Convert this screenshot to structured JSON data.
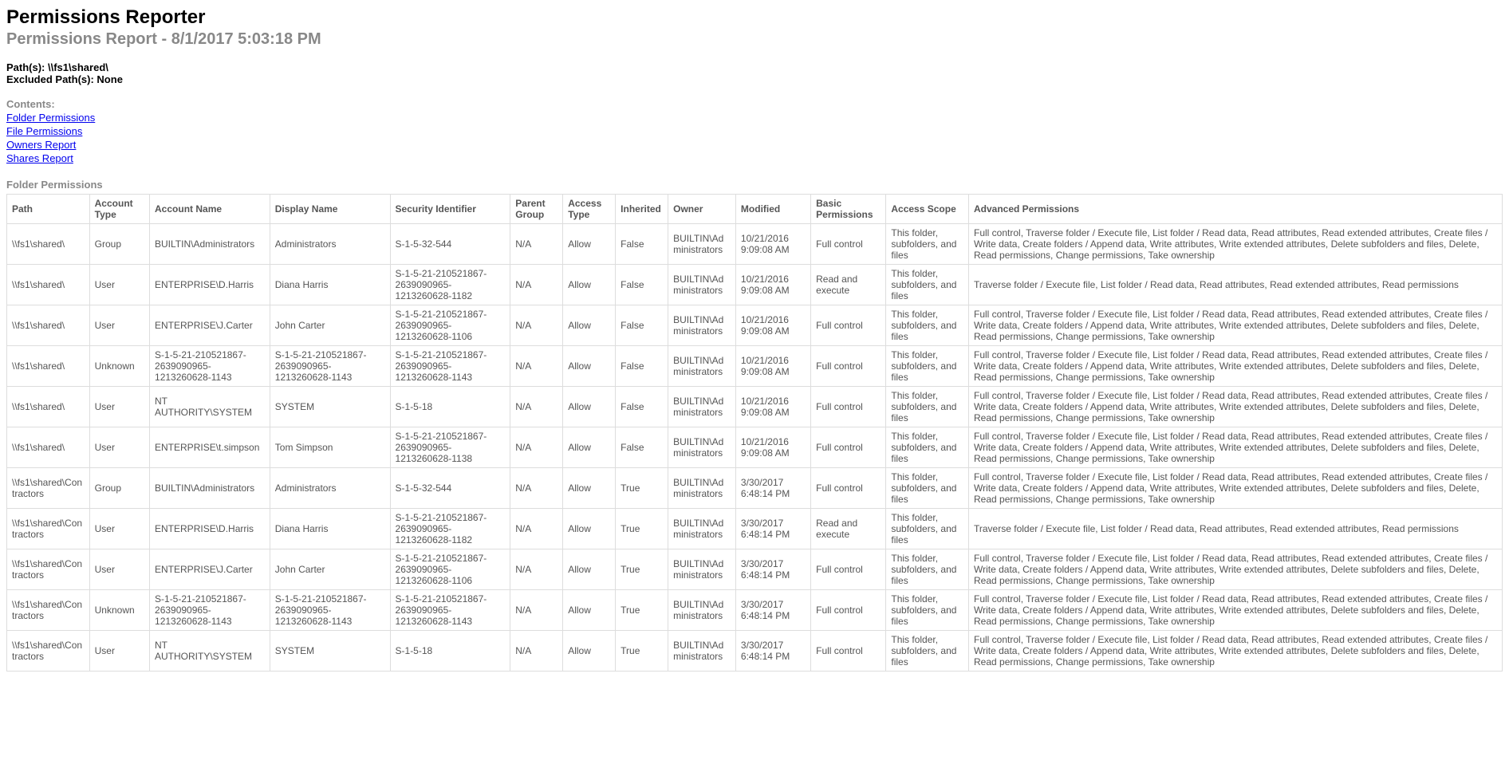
{
  "header": {
    "title": "Permissions Reporter",
    "subtitle": "Permissions Report - 8/1/2017 5:03:18 PM",
    "paths_label": "Path(s): ",
    "paths_value": "\\\\fs1\\shared\\",
    "excluded_label": "Excluded Path(s): ",
    "excluded_value": "None"
  },
  "contents": {
    "label": "Contents:",
    "links": [
      "Folder Permissions",
      "File Permissions",
      "Owners Report",
      "Shares Report"
    ]
  },
  "section": {
    "title": "Folder Permissions"
  },
  "table": {
    "headers": [
      "Path",
      "Account Type",
      "Account Name",
      "Display Name",
      "Security Identifier",
      "Parent Group",
      "Access Type",
      "Inherited",
      "Owner",
      "Modified",
      "Basic Permissions",
      "Access Scope",
      "Advanced Permissions"
    ],
    "rows": [
      {
        "path": "\\\\fs1\\shared\\",
        "acct_type": "Group",
        "acct_name": "BUILTIN\\Administrators",
        "display": "Administrators",
        "sid": "S-1-5-32-544",
        "parent": "N/A",
        "access": "Allow",
        "inherited": "False",
        "owner": "BUILTIN\\Administrators",
        "modified": "10/21/2016 9:09:08 AM",
        "basic": "Full control",
        "scope": "This folder, subfolders, and files",
        "advanced": "Full control, Traverse folder / Execute file, List folder / Read data, Read attributes, Read extended attributes, Create files / Write data, Create folders / Append data, Write attributes, Write extended attributes, Delete subfolders and files, Delete, Read permissions, Change permissions, Take ownership"
      },
      {
        "path": "\\\\fs1\\shared\\",
        "acct_type": "User",
        "acct_name": "ENTERPRISE\\D.Harris",
        "display": "Diana Harris",
        "sid": "S-1-5-21-210521867-2639090965-1213260628-1182",
        "parent": "N/A",
        "access": "Allow",
        "inherited": "False",
        "owner": "BUILTIN\\Administrators",
        "modified": "10/21/2016 9:09:08 AM",
        "basic": "Read and execute",
        "scope": "This folder, subfolders, and files",
        "advanced": "Traverse folder / Execute file, List folder / Read data, Read attributes, Read extended attributes, Read permissions"
      },
      {
        "path": "\\\\fs1\\shared\\",
        "acct_type": "User",
        "acct_name": "ENTERPRISE\\J.Carter",
        "display": "John Carter",
        "sid": "S-1-5-21-210521867-2639090965-1213260628-1106",
        "parent": "N/A",
        "access": "Allow",
        "inherited": "False",
        "owner": "BUILTIN\\Administrators",
        "modified": "10/21/2016 9:09:08 AM",
        "basic": "Full control",
        "scope": "This folder, subfolders, and files",
        "advanced": "Full control, Traverse folder / Execute file, List folder / Read data, Read attributes, Read extended attributes, Create files / Write data, Create folders / Append data, Write attributes, Write extended attributes, Delete subfolders and files, Delete, Read permissions, Change permissions, Take ownership"
      },
      {
        "path": "\\\\fs1\\shared\\",
        "acct_type": "Unknown",
        "acct_name": "S-1-5-21-210521867-2639090965-1213260628-1143",
        "display": "S-1-5-21-210521867-2639090965-1213260628-1143",
        "sid": "S-1-5-21-210521867-2639090965-1213260628-1143",
        "parent": "N/A",
        "access": "Allow",
        "inherited": "False",
        "owner": "BUILTIN\\Administrators",
        "modified": "10/21/2016 9:09:08 AM",
        "basic": "Full control",
        "scope": "This folder, subfolders, and files",
        "advanced": "Full control, Traverse folder / Execute file, List folder / Read data, Read attributes, Read extended attributes, Create files / Write data, Create folders / Append data, Write attributes, Write extended attributes, Delete subfolders and files, Delete, Read permissions, Change permissions, Take ownership"
      },
      {
        "path": "\\\\fs1\\shared\\",
        "acct_type": "User",
        "acct_name": "NT AUTHORITY\\SYSTEM",
        "display": "SYSTEM",
        "sid": "S-1-5-18",
        "parent": "N/A",
        "access": "Allow",
        "inherited": "False",
        "owner": "BUILTIN\\Administrators",
        "modified": "10/21/2016 9:09:08 AM",
        "basic": "Full control",
        "scope": "This folder, subfolders, and files",
        "advanced": "Full control, Traverse folder / Execute file, List folder / Read data, Read attributes, Read extended attributes, Create files / Write data, Create folders / Append data, Write attributes, Write extended attributes, Delete subfolders and files, Delete, Read permissions, Change permissions, Take ownership"
      },
      {
        "path": "\\\\fs1\\shared\\",
        "acct_type": "User",
        "acct_name": "ENTERPRISE\\t.simpson",
        "display": "Tom Simpson",
        "sid": "S-1-5-21-210521867-2639090965-1213260628-1138",
        "parent": "N/A",
        "access": "Allow",
        "inherited": "False",
        "owner": "BUILTIN\\Administrators",
        "modified": "10/21/2016 9:09:08 AM",
        "basic": "Full control",
        "scope": "This folder, subfolders, and files",
        "advanced": "Full control, Traverse folder / Execute file, List folder / Read data, Read attributes, Read extended attributes, Create files / Write data, Create folders / Append data, Write attributes, Write extended attributes, Delete subfolders and files, Delete, Read permissions, Change permissions, Take ownership"
      },
      {
        "path": "\\\\fs1\\shared\\Contractors",
        "acct_type": "Group",
        "acct_name": "BUILTIN\\Administrators",
        "display": "Administrators",
        "sid": "S-1-5-32-544",
        "parent": "N/A",
        "access": "Allow",
        "inherited": "True",
        "owner": "BUILTIN\\Administrators",
        "modified": "3/30/2017 6:48:14 PM",
        "basic": "Full control",
        "scope": "This folder, subfolders, and files",
        "advanced": "Full control, Traverse folder / Execute file, List folder / Read data, Read attributes, Read extended attributes, Create files / Write data, Create folders / Append data, Write attributes, Write extended attributes, Delete subfolders and files, Delete, Read permissions, Change permissions, Take ownership"
      },
      {
        "path": "\\\\fs1\\shared\\Contractors",
        "acct_type": "User",
        "acct_name": "ENTERPRISE\\D.Harris",
        "display": "Diana Harris",
        "sid": "S-1-5-21-210521867-2639090965-1213260628-1182",
        "parent": "N/A",
        "access": "Allow",
        "inherited": "True",
        "owner": "BUILTIN\\Administrators",
        "modified": "3/30/2017 6:48:14 PM",
        "basic": "Read and execute",
        "scope": "This folder, subfolders, and files",
        "advanced": "Traverse folder / Execute file, List folder / Read data, Read attributes, Read extended attributes, Read permissions"
      },
      {
        "path": "\\\\fs1\\shared\\Contractors",
        "acct_type": "User",
        "acct_name": "ENTERPRISE\\J.Carter",
        "display": "John Carter",
        "sid": "S-1-5-21-210521867-2639090965-1213260628-1106",
        "parent": "N/A",
        "access": "Allow",
        "inherited": "True",
        "owner": "BUILTIN\\Administrators",
        "modified": "3/30/2017 6:48:14 PM",
        "basic": "Full control",
        "scope": "This folder, subfolders, and files",
        "advanced": "Full control, Traverse folder / Execute file, List folder / Read data, Read attributes, Read extended attributes, Create files / Write data, Create folders / Append data, Write attributes, Write extended attributes, Delete subfolders and files, Delete, Read permissions, Change permissions, Take ownership"
      },
      {
        "path": "\\\\fs1\\shared\\Contractors",
        "acct_type": "Unknown",
        "acct_name": "S-1-5-21-210521867-2639090965-1213260628-1143",
        "display": "S-1-5-21-210521867-2639090965-1213260628-1143",
        "sid": "S-1-5-21-210521867-2639090965-1213260628-1143",
        "parent": "N/A",
        "access": "Allow",
        "inherited": "True",
        "owner": "BUILTIN\\Administrators",
        "modified": "3/30/2017 6:48:14 PM",
        "basic": "Full control",
        "scope": "This folder, subfolders, and files",
        "advanced": "Full control, Traverse folder / Execute file, List folder / Read data, Read attributes, Read extended attributes, Create files / Write data, Create folders / Append data, Write attributes, Write extended attributes, Delete subfolders and files, Delete, Read permissions, Change permissions, Take ownership"
      },
      {
        "path": "\\\\fs1\\shared\\Contractors",
        "acct_type": "User",
        "acct_name": "NT AUTHORITY\\SYSTEM",
        "display": "SYSTEM",
        "sid": "S-1-5-18",
        "parent": "N/A",
        "access": "Allow",
        "inherited": "True",
        "owner": "BUILTIN\\Administrators",
        "modified": "3/30/2017 6:48:14 PM",
        "basic": "Full control",
        "scope": "This folder, subfolders, and files",
        "advanced": "Full control, Traverse folder / Execute file, List folder / Read data, Read attributes, Read extended attributes, Create files / Write data, Create folders / Append data, Write attributes, Write extended attributes, Delete subfolders and files, Delete, Read permissions, Change permissions, Take ownership"
      }
    ]
  }
}
